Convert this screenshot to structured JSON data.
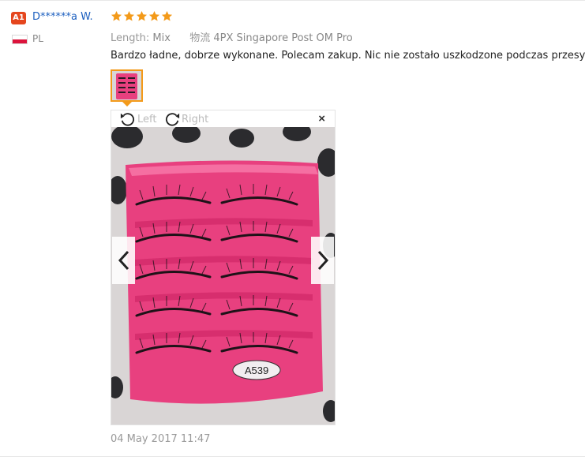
{
  "reviewer": {
    "badge": "A1",
    "name": "D******a W.",
    "country": "PL",
    "flag_colors": [
      "#ffffff",
      "#dc143c"
    ]
  },
  "rating": {
    "stars": 5,
    "max": 5,
    "color": "#f39a1a"
  },
  "meta": {
    "length_label": "Length:",
    "length_value": "Mix",
    "shipping_label": "物流",
    "shipping_value": "4PX Singapore Post OM Pro"
  },
  "review_text": "Bardzo ładne, dobrze wykonane. Polecam zakup. Nic nie zostało uszkodzone podczas przesyłki.",
  "viewer": {
    "rotate_left_label": "Left",
    "rotate_right_label": "Right",
    "close_label": "×",
    "photo_label": "A539"
  },
  "timestamp": "04 May 2017 11:47",
  "colors": {
    "accent": "#f39a1a",
    "link": "#1c5fbf",
    "badge": "#e5461e",
    "tray": "#e8407f"
  }
}
